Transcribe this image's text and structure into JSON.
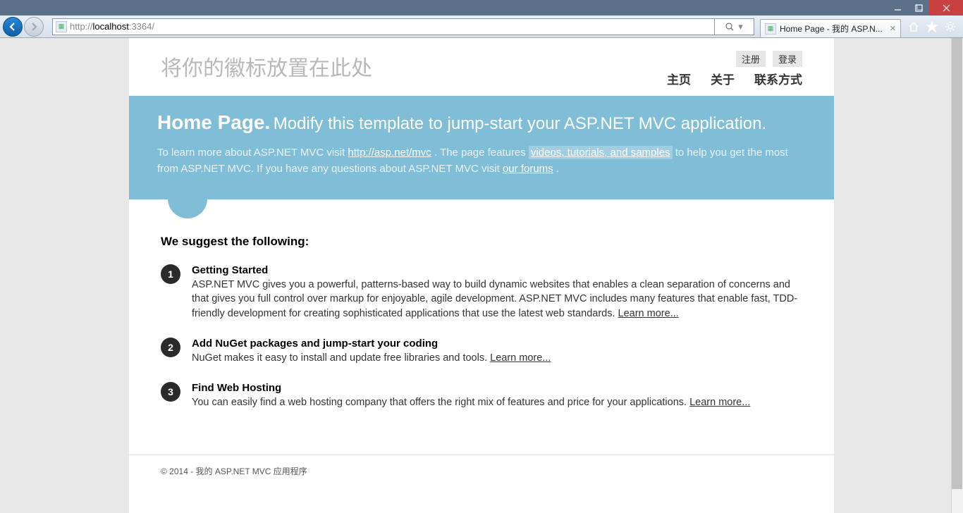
{
  "browser": {
    "url_prefix": "http://",
    "url_host": "localhost",
    "url_suffix": ":3364/",
    "tab_title": "Home Page - 我的 ASP.N...",
    "search_glyph": "🔍"
  },
  "header": {
    "logo": "将你的徽标放置在此处",
    "register": "注册",
    "login": "登录",
    "nav": {
      "home": "主页",
      "about": "关于",
      "contact": "联系方式"
    }
  },
  "hero": {
    "title": "Home Page.",
    "subtitle": "Modify this template to jump-start your ASP.NET MVC application.",
    "p1a": "To learn more about ASP.NET MVC visit ",
    "link1": "http://asp.net/mvc",
    "p1b": " . The page features ",
    "link2": "videos, tutorials, and samples",
    "p1c": "  to help you get the most from ASP.NET MVC. If you have any questions about ASP.NET MVC visit ",
    "link3": "our forums",
    "p1d": " ."
  },
  "content": {
    "heading": "We suggest the following:",
    "steps": [
      {
        "num": "1",
        "title": "Getting Started",
        "body": "ASP.NET MVC gives you a powerful, patterns-based way to build dynamic websites that enables a clean separation of concerns and that gives you full control over markup for enjoyable, agile development. ASP.NET MVC includes many features that enable fast, TDD-friendly development for creating sophisticated applications that use the latest web standards.  ",
        "more": "Learn more..."
      },
      {
        "num": "2",
        "title": "Add NuGet packages and jump-start your coding",
        "body": "NuGet makes it easy to install and update free libraries and tools.  ",
        "more": "Learn more..."
      },
      {
        "num": "3",
        "title": "Find Web Hosting",
        "body": "You can easily find a web hosting company that offers the right mix of features and price for your applications.  ",
        "more": "Learn more..."
      }
    ]
  },
  "footer": "© 2014 - 我的 ASP.NET MVC 应用程序"
}
